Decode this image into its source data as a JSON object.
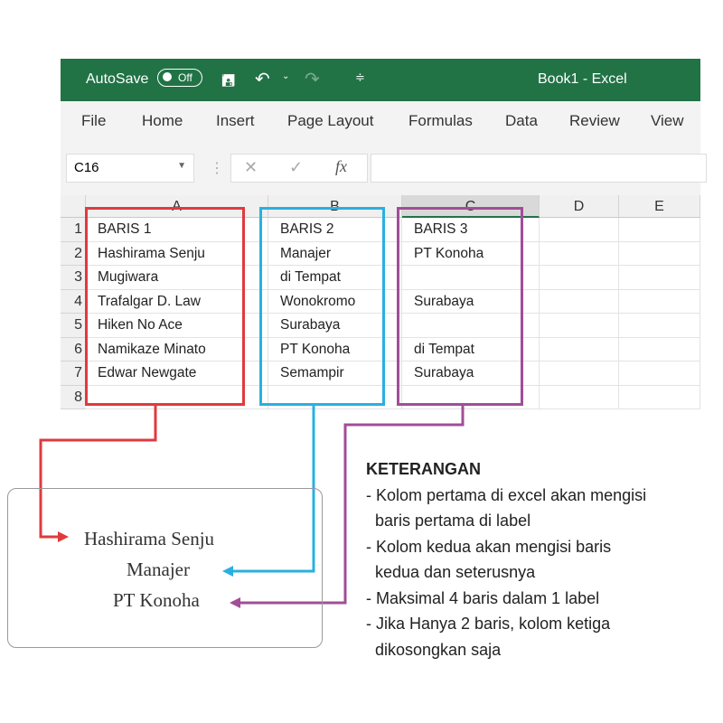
{
  "titlebar": {
    "autosave": "AutoSave",
    "toggle": "Off",
    "title": "Book1  -  Excel"
  },
  "ribbon": [
    "File",
    "Home",
    "Insert",
    "Page Layout",
    "Formulas",
    "Data",
    "Review",
    "View"
  ],
  "formula_bar": {
    "name_box": "C16",
    "cancel": "✕",
    "enter": "✓",
    "fx": "fx",
    "value": ""
  },
  "columns": [
    "A",
    "B",
    "C",
    "D",
    "E"
  ],
  "rows": [
    "1",
    "2",
    "3",
    "4",
    "5",
    "6",
    "7",
    "8"
  ],
  "cells": [
    [
      "BARIS 1",
      "BARIS 2",
      "BARIS 3"
    ],
    [
      "Hashirama Senju",
      "Manajer",
      "PT Konoha"
    ],
    [
      "Mugiwara",
      "di Tempat",
      ""
    ],
    [
      "Trafalgar D. Law",
      "Wonokromo",
      "Surabaya"
    ],
    [
      "Hiken No Ace",
      "Surabaya",
      ""
    ],
    [
      "Namikaze Minato",
      "PT Konoha",
      "di Tempat"
    ],
    [
      "Edwar Newgate",
      "Semampir",
      "Surabaya"
    ],
    [
      "",
      "",
      ""
    ]
  ],
  "label": [
    "Hashirama Senju",
    "Manajer",
    "PT Konoha"
  ],
  "keterangan": {
    "title": "KETERANGAN",
    "lines": [
      "- Kolom pertama di excel akan mengisi",
      "  baris pertama di label",
      "- Kolom kedua akan mengisi baris",
      "  kedua dan seterusnya",
      "- Maksimal 4 baris dalam 1 label",
      "- Jika Hanya 2 baris, kolom ketiga",
      "  dikosongkan saja"
    ]
  },
  "colors": {
    "excel_green": "#217346",
    "red": "#e03a3e",
    "blue": "#29b0e0",
    "purple": "#a24d97"
  }
}
